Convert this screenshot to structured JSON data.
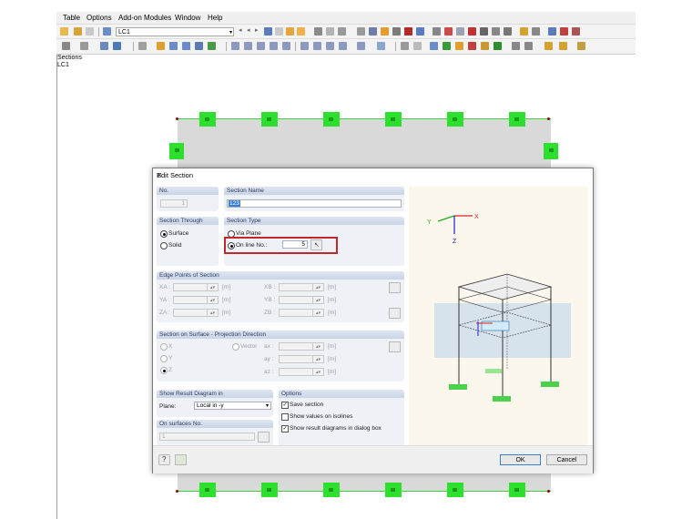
{
  "menubar": {
    "items": [
      "Table",
      "Options",
      "Add-on Modules",
      "Window",
      "Help"
    ]
  },
  "toolbar": {
    "loadcase": "LC1"
  },
  "navigator": {
    "line1": "Sections",
    "line2": "LC1"
  },
  "dialog": {
    "title": "Edit Section",
    "no_header": "No.",
    "no_value": "1",
    "section_name_header": "Section Name",
    "section_name_value": "123",
    "section_through_header": "Section Through",
    "surface_label": "Surface",
    "solid_label": "Solid",
    "section_type_header": "Section Type",
    "via_plane_label": "Via Plane",
    "on_line_label": "On line No.:",
    "on_line_value": "5",
    "edge_points_header": "Edge Points of Section",
    "xa": "XA :",
    "ya": "YA :",
    "za": "ZA :",
    "xb": "XB :",
    "yb": "YB :",
    "zb": "ZB :",
    "unit_m": "[m]",
    "projection_header": "Section on Surface - Projection Direction",
    "proj_x": "X",
    "proj_y": "Y",
    "proj_z": "Z",
    "vector_label": "Vector",
    "ax": "ax :",
    "ay": "ay :",
    "az": "az :",
    "show_result_header": "Show Result Diagram in",
    "plane_label": "Plane:",
    "plane_value": "Local in -y",
    "on_surfaces_header": "On surfaces No.",
    "on_surfaces_value": "1",
    "options_header": "Options",
    "save_section": "Save section",
    "show_values": "Show values on isolines",
    "show_result_dialog": "Show result diagrams in dialog box",
    "save_checked": true,
    "show_values_checked": false,
    "show_result_checked": true,
    "ok": "OK",
    "cancel": "Cancel"
  },
  "preview": {
    "axis_y": "Y",
    "axis_x": "X",
    "axis_z": "Z"
  },
  "colors": {
    "highlight": "#c0282d",
    "support_green": "#2ee02e",
    "model_gray": "#d9d9d9"
  }
}
